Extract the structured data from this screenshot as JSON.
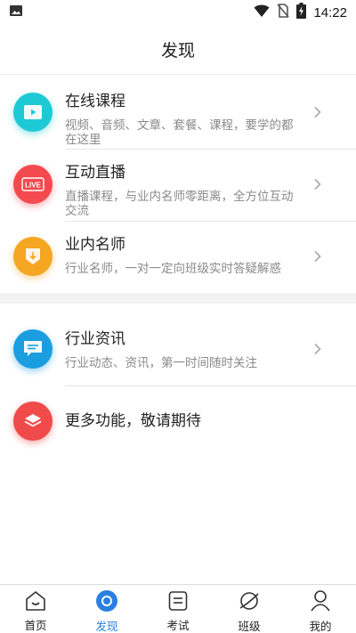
{
  "status_bar": {
    "time": "14:22",
    "left_icon": "image-notification-icon",
    "right_icons": [
      "wifi-icon",
      "no-sim-icon",
      "battery-charging-icon"
    ]
  },
  "header": {
    "title": "发现"
  },
  "list": [
    {
      "title": "在线课程",
      "desc": "视频、音频、文章、套餐、课程，要学的都在这里",
      "icon": "video-play-icon",
      "color": "#1ec9d6"
    },
    {
      "title": "互动直播",
      "desc": "直播课程，与业内名师零距离，全方位互动交流",
      "icon": "live-icon",
      "icon_text": "LIVE",
      "color": "#f24a4f"
    },
    {
      "title": "业内名师",
      "desc": "行业名师，一对一定向班级实时答疑解惑",
      "icon": "teacher-badge-icon",
      "color": "#f5a623"
    },
    {
      "title": "行业资讯",
      "desc": "行业动态、资讯，第一时间随时关注",
      "icon": "message-icon",
      "color": "#1a9ee0"
    },
    {
      "title": "更多功能，敬请期待",
      "icon": "layers-icon",
      "color": "#f04a4a"
    }
  ],
  "bottom_nav": [
    {
      "label": "首页",
      "icon": "home-icon",
      "active": false
    },
    {
      "label": "发现",
      "icon": "discover-icon",
      "active": true
    },
    {
      "label": "考试",
      "icon": "exam-icon",
      "active": false
    },
    {
      "label": "班级",
      "icon": "class-planet-icon",
      "active": false
    },
    {
      "label": "我的",
      "icon": "profile-icon",
      "active": false
    }
  ],
  "colors": {
    "accent": "#2b7fe0",
    "text_primary": "#222222",
    "text_secondary": "#8a8a8a"
  }
}
